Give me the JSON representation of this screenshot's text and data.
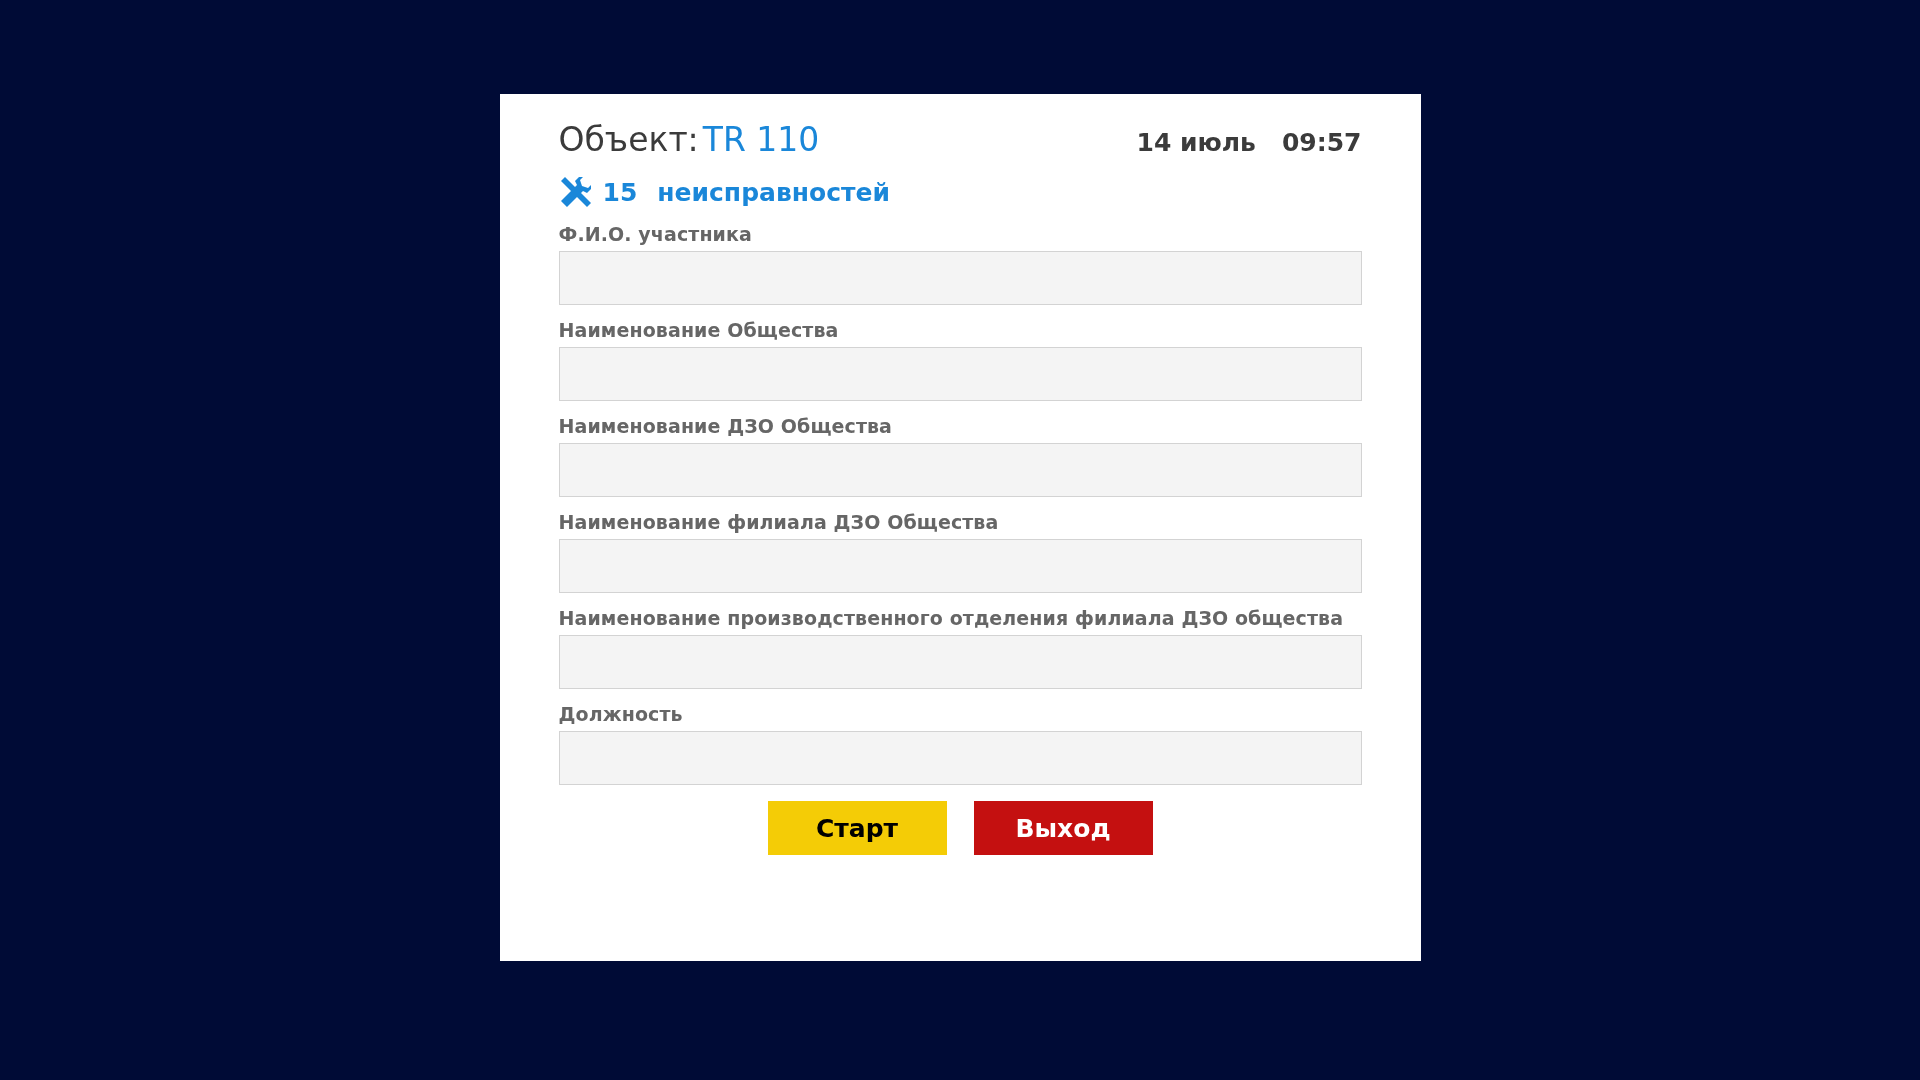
{
  "header": {
    "object_label": "Объект:",
    "object_value": "TR 110",
    "date": "14 июль",
    "time": "09:57"
  },
  "faults": {
    "count": "15",
    "label": "неисправностей"
  },
  "fields": [
    {
      "label": "Ф.И.О. участника"
    },
    {
      "label": "Наименование Общества"
    },
    {
      "label": "Наименование ДЗО Общества"
    },
    {
      "label": "Наименование филиала ДЗО Общества"
    },
    {
      "label": "Наименование производственного отделения филиала ДЗО общества"
    },
    {
      "label": "Должность"
    }
  ],
  "buttons": [
    {
      "label": "Старт",
      "kind": "start"
    },
    {
      "label": "Выход",
      "kind": "exit"
    }
  ]
}
